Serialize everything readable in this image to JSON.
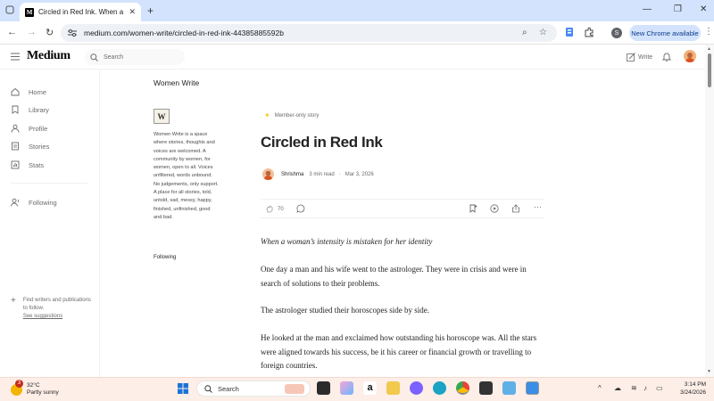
{
  "browser": {
    "tab_title": "Circled in Red Ink. When a wom",
    "tab_favicon": "M",
    "url": "medium.com/women-write/circled-in-red-ink-44385885592b",
    "profile_initial": "S",
    "new_chrome_label": "New Chrome available"
  },
  "header": {
    "logo": "Medium",
    "search_placeholder": "Search",
    "write_label": "Write"
  },
  "sidebar": {
    "items": [
      {
        "label": "Home",
        "icon": "home-icon"
      },
      {
        "label": "Library",
        "icon": "library-icon"
      },
      {
        "label": "Profile",
        "icon": "profile-icon"
      },
      {
        "label": "Stories",
        "icon": "stories-icon"
      },
      {
        "label": "Stats",
        "icon": "stats-icon"
      },
      {
        "label": "Following",
        "icon": "following-icon"
      }
    ],
    "find_text": "Find writers and publications to follow.",
    "see_suggestions": "See suggestions"
  },
  "publication": {
    "name": "Women Write",
    "logo_text": "W",
    "description": "Women Write is a space where stories, thoughts and voices are welcomed. A community by women, for women, open to all. Voices unfiltered, words unbound. No judgements, only support. A place for all stories, told, untold, sad, messy, happy, finished, unfinished, good and bad.",
    "follow_label": "Following"
  },
  "article": {
    "badge": "Member-only story",
    "title": "Circled in Red Ink",
    "author": "Shrishma",
    "read_time": "3 min read",
    "date": "Mar 3, 2026",
    "claps": "70",
    "subtitle": "When a woman’s intensity is mistaken for her identity",
    "paragraphs": [
      "One day a man and his wife went to the astrologer. They were in crisis and were in search of solutions to their problems.",
      "The astrologer studied their horoscopes side by side.",
      "He looked at the man and exclaimed how outstanding his horoscope was. All the stars were aligned towards his success, be it his career or financial growth or travelling to foreign countries."
    ]
  },
  "taskbar": {
    "weather_temp": "32°C",
    "weather_desc": "Partly sunny",
    "weather_badge": "3",
    "search_label": "Search",
    "time": "3:14 PM",
    "date": "3/24/2026"
  },
  "colors": {
    "accent_star": "#ffc017",
    "tab_bar": "#d3e3fd",
    "taskbar": "#fdeee8"
  }
}
